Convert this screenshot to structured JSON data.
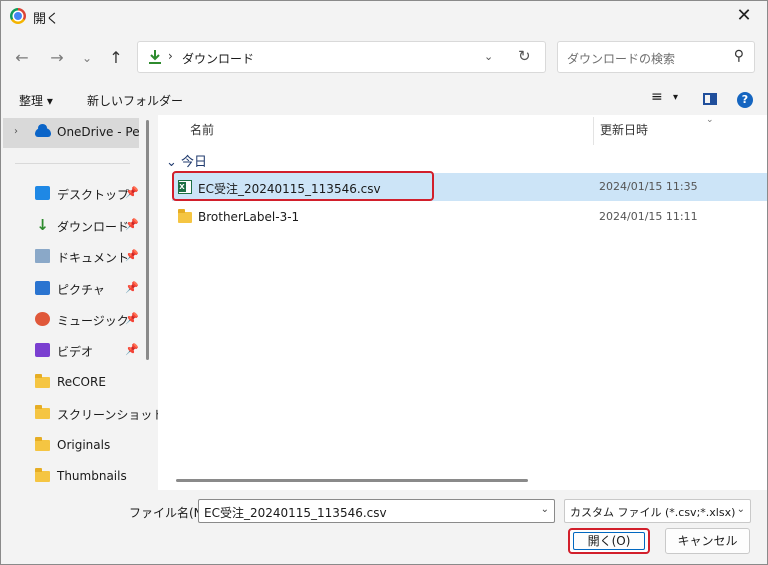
{
  "window": {
    "title": "開く",
    "close_glyph": "✕"
  },
  "nav": {
    "back_glyph": "←",
    "forward_glyph": "→",
    "recent_glyph": "⌄",
    "up_glyph": "↑",
    "address_sep": "›",
    "address_text": "ダウンロード",
    "address_dropdown_glyph": "⌄",
    "refresh_glyph": "↻",
    "search_placeholder": "ダウンロードの検索",
    "search_glyph": "⚲"
  },
  "toolbar": {
    "organize_label": "整理 ▾",
    "new_folder_label": "新しいフォルダー",
    "view_glyph": "≡",
    "view_drop_glyph": "▾",
    "help_glyph": "?"
  },
  "sidebar": {
    "onedrive_chevron": "›",
    "onedrive_label": "OneDrive - Personal",
    "pin_glyph": "📌",
    "items": [
      {
        "label": "デスクトップ",
        "pinned": true
      },
      {
        "label": "ダウンロード",
        "pinned": true
      },
      {
        "label": "ドキュメント",
        "pinned": true
      },
      {
        "label": "ピクチャ",
        "pinned": true
      },
      {
        "label": "ミュージック",
        "pinned": true
      },
      {
        "label": "ビデオ",
        "pinned": true
      },
      {
        "label": "ReCORE",
        "pinned": false
      },
      {
        "label": "スクリーンショット",
        "pinned": false
      },
      {
        "label": "Originals",
        "pinned": false
      },
      {
        "label": "Thumbnails",
        "pinned": false
      }
    ]
  },
  "files": {
    "col_name": "名前",
    "col_date": "更新日時",
    "sort_glyph": "⌄",
    "group_label": "⌄ 今日",
    "rows": [
      {
        "name": "EC受注_20240115_113546.csv",
        "date": "2024/01/15 11:35",
        "selected": true,
        "type": "excel"
      },
      {
        "name": "BrotherLabel-3-1",
        "date": "2024/01/15 11:11",
        "selected": false,
        "type": "folder"
      }
    ]
  },
  "footer": {
    "filename_label": "ファイル名(N):",
    "filename_value": "EC受注_20240115_113546.csv",
    "filetype_value": "カスタム ファイル (*.csv;*.xlsx)",
    "dropdown_glyph": "⌄",
    "open_label": "開く(O)",
    "cancel_label": "キャンセル"
  },
  "colors": {
    "selection": "#cce4f7",
    "highlight_outline": "#d21f2b",
    "accent": "#0067c0"
  }
}
